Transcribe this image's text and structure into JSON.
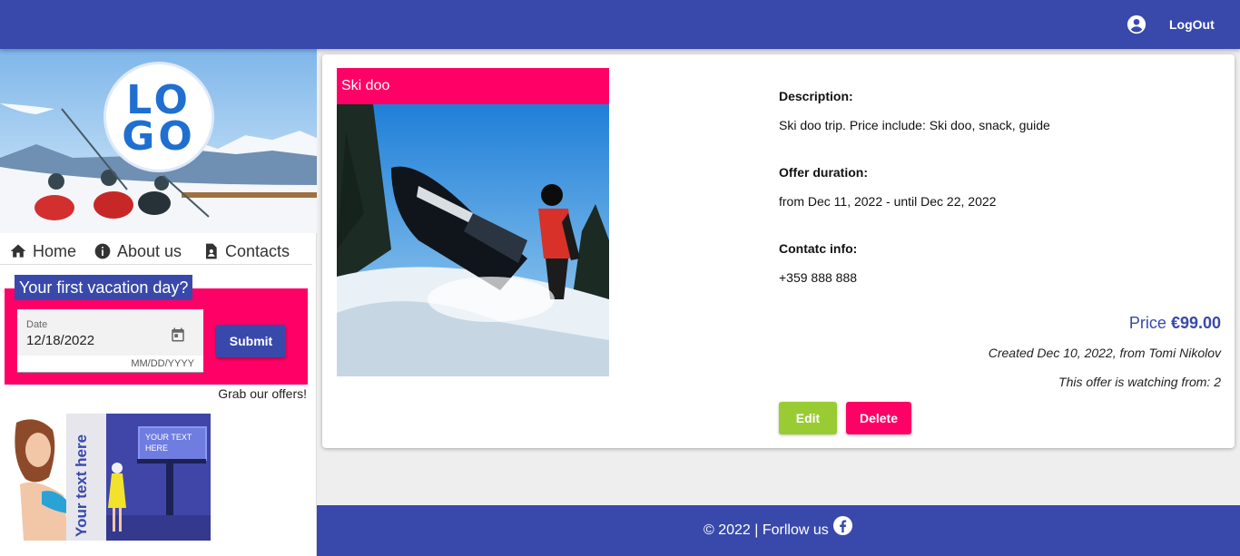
{
  "topbar": {
    "logout_label": "LogOut",
    "user_icon": "account-circle-icon"
  },
  "sidebar": {
    "logo_text_1": "LO",
    "logo_text_2": "GO",
    "nav": [
      {
        "label": "Home",
        "icon": "home-icon"
      },
      {
        "label": "About us",
        "icon": "info-icon"
      },
      {
        "label": "Contacts",
        "icon": "contact-icon"
      }
    ],
    "vacation": {
      "title": "Your first vacation day?",
      "date_label": "Date",
      "date_value": "12/18/2022",
      "date_hint": "MM/DD/YYYY",
      "submit_label": "Submit",
      "grab_text": "Grab our offers!"
    },
    "ad": {
      "vertical_text": "Your text here",
      "billboard_text": "YOUR TEXT HERE"
    }
  },
  "offer": {
    "title": "Ski doo",
    "description_label": "Description:",
    "description": "Ski doo trip. Price include: Ski doo, snack, guide",
    "duration_label": "Offer duration:",
    "duration": "from Dec 11, 2022 - until Dec 22, 2022",
    "contact_label": "Contatc info:",
    "contact": "+359 888 888",
    "price_label": "Price",
    "price_value": "€99.00",
    "created": "Created Dec 10, 2022, from Tomi Nikolov",
    "watching": "This offer is watching from: 2",
    "edit_label": "Edit",
    "delete_label": "Delete"
  },
  "footer": {
    "text": "© 2022 | Forllow us",
    "icon": "facebook-icon"
  },
  "colors": {
    "primary": "#3949ab",
    "accent": "#ff0066",
    "edit": "#99cc33"
  }
}
